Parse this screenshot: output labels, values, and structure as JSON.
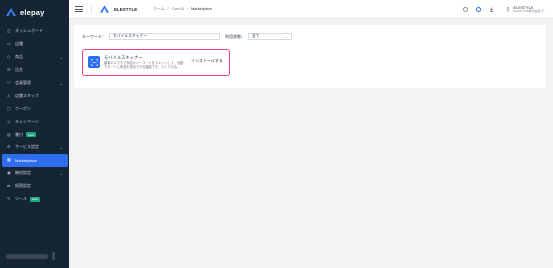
{
  "app": {
    "logo_text": "elepay"
  },
  "sidebar": {
    "items": [
      {
        "label": "ダッシュボード",
        "icon": "dashboard-icon"
      },
      {
        "label": "店舗",
        "icon": "store-icon"
      },
      {
        "label": "商品",
        "icon": "tag-icon",
        "has_chevron": true
      },
      {
        "label": "注文",
        "icon": "list-icon"
      },
      {
        "label": "会員管理",
        "icon": "people-icon",
        "has_chevron": true
      },
      {
        "label": "店舗スタッフ",
        "icon": "person-icon"
      },
      {
        "label": "クーポン",
        "icon": "coupon-icon"
      },
      {
        "label": "キャンペーン",
        "icon": "megaphone-icon"
      },
      {
        "label": "書付",
        "icon": "doc-icon",
        "badge": "beta"
      },
      {
        "label": "サービス設定",
        "icon": "settings-icon",
        "has_chevron": true
      },
      {
        "label": "Marketplace",
        "icon": "grid-icon",
        "active": true
      },
      {
        "label": "機材設定",
        "icon": "device-icon",
        "has_chevron": true
      },
      {
        "label": "振替設定",
        "icon": "transfer-icon"
      },
      {
        "label": "ツール",
        "icon": "tool-icon",
        "badge": "beta"
      }
    ]
  },
  "header": {
    "brand": "ELESTYLE",
    "breadcrumb": [
      "ホーム",
      "Over24",
      "Marketplace"
    ],
    "user_name": "ELESTYLE",
    "user_sub": "ELESTYLE株式会社(テ..."
  },
  "filters": {
    "keyword_label": "キーワード：",
    "keyword_value": "モバイルスキャナー",
    "status_label": "利用状態：",
    "status_value": "全て"
  },
  "app_card": {
    "title": "モバイルスキャナー",
    "description": "顧客のスマホで商品のバーコードをスキャンして、自動でカートに商品を追加できる機能です。ストアの込...",
    "install_label": "インストールする"
  },
  "colors": {
    "accent": "#2f6df0",
    "highlight": "#e8407a",
    "sidebar_bg": "#152536"
  }
}
